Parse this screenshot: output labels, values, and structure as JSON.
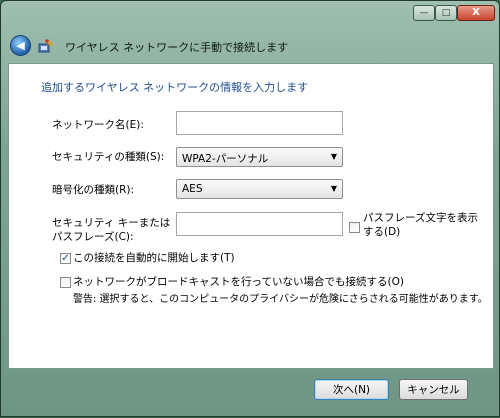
{
  "window": {
    "title": "ワイヤレス ネットワークに手動で接続します",
    "controls": {
      "minimize": "—",
      "maximize": "□",
      "close": "X"
    },
    "back_glyph": "◀"
  },
  "form": {
    "instruction": "追加するワイヤレス ネットワークの情報を入力します",
    "network_name": {
      "label": "ネットワーク名(E):",
      "value": ""
    },
    "security_type": {
      "label": "セキュリティの種類(S):",
      "value": "WPA2-パーソナル"
    },
    "encryption_type": {
      "label": "暗号化の種類(R):",
      "value": "AES"
    },
    "security_key": {
      "label_line1": "セキュリティ キーまたは",
      "label_line2": "パスフレーズ(C):",
      "value": ""
    },
    "show_characters": {
      "label_line1": "パスフレーズ文字を表示",
      "label_line2": "する(D)",
      "checked": false
    },
    "auto_start": {
      "label": "この接続を自動的に開始します(T)",
      "checked": true,
      "mark": "✓"
    },
    "connect_hidden": {
      "label": "ネットワークがブロードキャストを行っていない場合でも接続する(O)",
      "checked": false
    },
    "warning": "警告: 選択すると、このコンピュータのプライバシーが危険にさらされる可能性があります。"
  },
  "buttons": {
    "next": "次へ(N)",
    "cancel": "キャンセル"
  },
  "colors": {
    "instruction": "#1f4e8c",
    "frame": "#7ea594",
    "checkmark": "#1c4f93"
  }
}
